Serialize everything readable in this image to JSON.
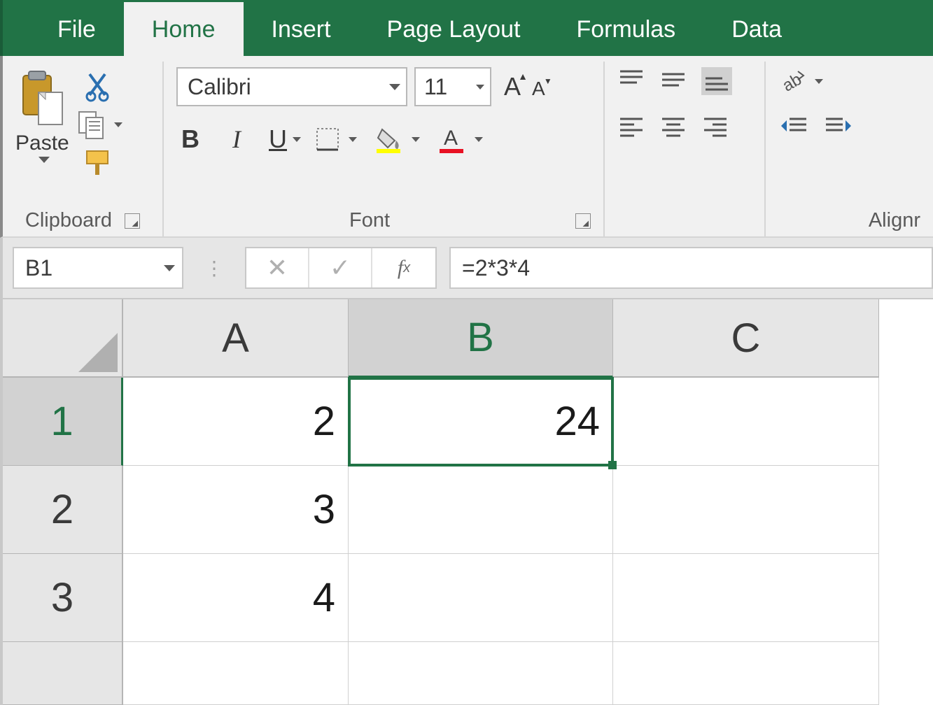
{
  "tabs": {
    "file": "File",
    "home": "Home",
    "insert": "Insert",
    "page_layout": "Page Layout",
    "formulas": "Formulas",
    "data": "Data"
  },
  "active_tab": "Home",
  "ribbon": {
    "clipboard": {
      "label": "Clipboard",
      "paste": "Paste"
    },
    "font": {
      "label": "Font",
      "name": "Calibri",
      "size": "11",
      "bold": "B",
      "italic": "I",
      "underline": "U"
    },
    "alignment": {
      "label": "Alignr"
    }
  },
  "name_box": "B1",
  "formula_bar": "=2*3*4",
  "columns": [
    "A",
    "B",
    "C"
  ],
  "rows": [
    "1",
    "2",
    "3"
  ],
  "selected_cell": "B1",
  "cells": {
    "A1": "2",
    "B1": "24",
    "C1": "",
    "A2": "3",
    "B2": "",
    "C2": "",
    "A3": "4",
    "B3": "",
    "C3": ""
  }
}
